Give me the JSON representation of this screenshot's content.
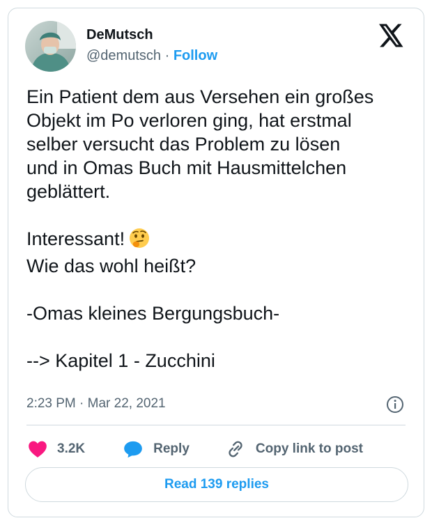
{
  "author": {
    "name": "DeMutsch",
    "handle": "@demutsch",
    "separator": "·",
    "follow_label": "Follow"
  },
  "tweet": {
    "lines_block1": [
      "Ein Patient dem aus Versehen ein großes",
      "Objekt im Po verloren ging, hat erstmal",
      "selber versucht das Problem zu lösen",
      "und in Omas Buch mit Hausmittelchen",
      "geblättert."
    ],
    "line_interessant": "Interessant!",
    "emoji": "thinking-face",
    "line_wie": "Wie das wohl heißt?",
    "line_omas": "-Omas kleines Bergungsbuch-",
    "line_kapitel": "--> Kapitel 1 - Zucchini"
  },
  "meta": {
    "time": "2:23 PM",
    "separator": "·",
    "date": "Mar 22, 2021"
  },
  "actions": {
    "like_count": "3.2K",
    "reply_label": "Reply",
    "copy_label": "Copy link to post"
  },
  "read_replies_label": "Read 139 replies",
  "colors": {
    "accent": "#1d9bf0",
    "like": "#f91880",
    "text": "#0f1419",
    "secondary": "#536471",
    "border": "#cfd9de"
  },
  "icons": [
    "x-logo-icon",
    "info-icon",
    "heart-icon",
    "reply-bubble-icon",
    "link-icon",
    "thinking-face-emoji"
  ]
}
